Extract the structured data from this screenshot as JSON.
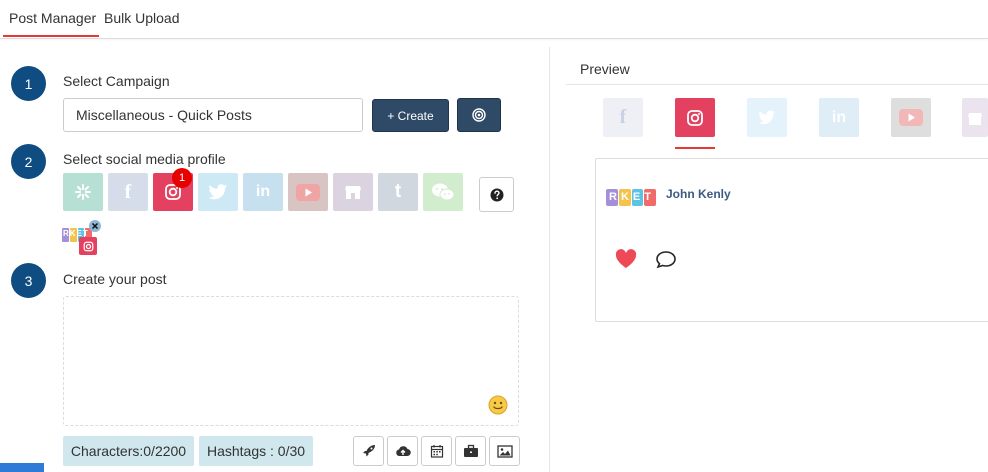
{
  "tabs": {
    "active": "Post Manager",
    "second": "Bulk Upload"
  },
  "steps": [
    {
      "number": "1",
      "label": "Select Campaign"
    },
    {
      "number": "2",
      "label": "Select social media profile"
    },
    {
      "number": "3",
      "label": "Create your post"
    }
  ],
  "campaign": {
    "selected": "Miscellaneous - Quick Posts",
    "create_label": "+ Create"
  },
  "profiles": {
    "instagram_badge": "1",
    "facebook_glyph": "f",
    "linkedin_glyph": "in",
    "tumblr_glyph": "t"
  },
  "selected_profile_logo": "RKET",
  "post": {
    "characters_label": "Characters:0/2200",
    "hashtags_label": "Hashtags : 0/30"
  },
  "preview": {
    "title": "Preview",
    "user_name": "John Kenly",
    "logo_text": "RKET"
  },
  "colors": {
    "primary_dark": "#2f4a66",
    "step_blue": "#0f4c81",
    "instagram": "#e4405f",
    "accent_red": "#e53935"
  }
}
